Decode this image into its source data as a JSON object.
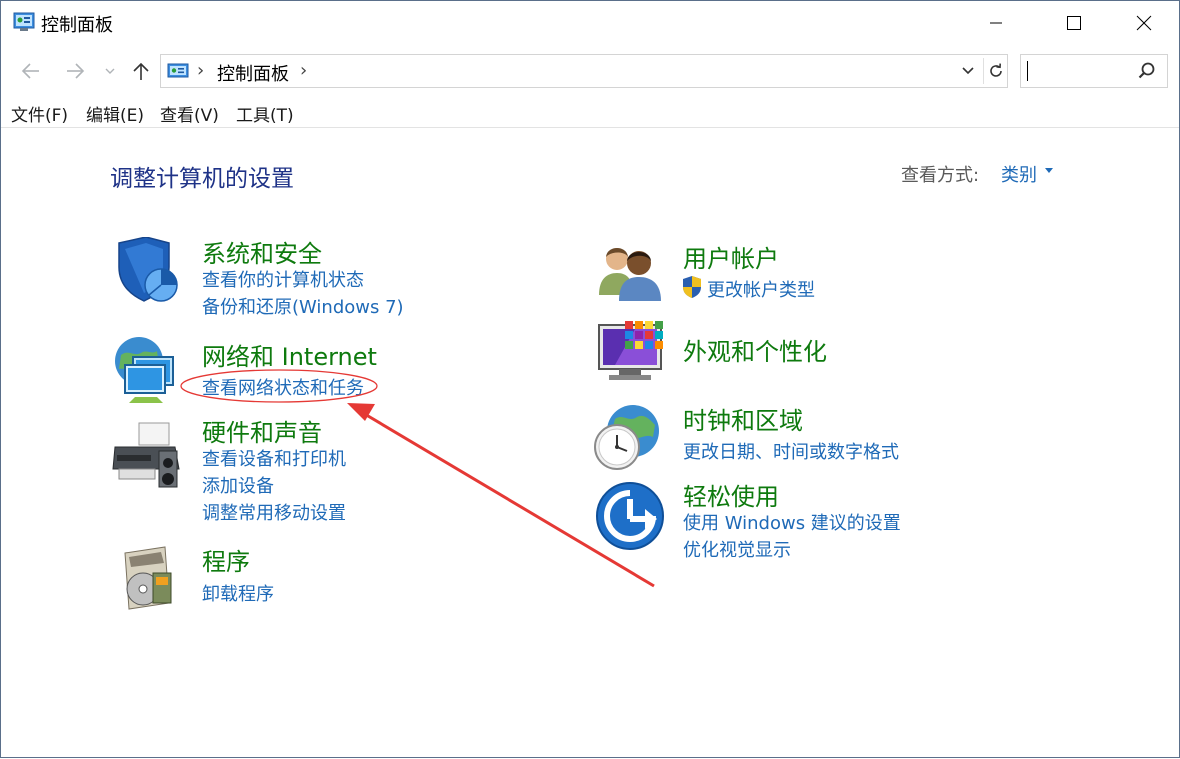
{
  "window": {
    "title": "控制面板",
    "minimize_icon": "minimize-icon",
    "maximize_icon": "maximize-icon",
    "close_icon": "close-icon"
  },
  "nav": {
    "back_icon": "arrow-left-icon",
    "forward_icon": "arrow-right-icon",
    "recent_icon": "chevron-down-icon",
    "up_icon": "arrow-up-icon",
    "address": {
      "breadcrumb": "控制面板",
      "separator": "›"
    },
    "search": {
      "placeholder": ""
    }
  },
  "menu": {
    "items": [
      "文件(F)",
      "编辑(E)",
      "查看(V)",
      "工具(T)"
    ]
  },
  "main": {
    "title": "调整计算机的设置",
    "view_by_label": "查看方式:",
    "view_by_value": "类别",
    "categories": [
      {
        "title": "系统和安全",
        "icon": "shield-icon",
        "links": [
          "查看你的计算机状态",
          "备份和还原(Windows 7)"
        ]
      },
      {
        "title": "网络和 Internet",
        "icon": "network-globe-icon",
        "links": [
          "查看网络状态和任务"
        ]
      },
      {
        "title": "硬件和声音",
        "icon": "printer-icon",
        "links": [
          "查看设备和打印机",
          "添加设备",
          "调整常用移动设置"
        ]
      },
      {
        "title": "程序",
        "icon": "programs-disc-icon",
        "links": [
          "卸载程序"
        ]
      },
      {
        "title": "用户帐户",
        "icon": "users-icon",
        "links": [
          "更改帐户类型"
        ]
      },
      {
        "title": "外观和个性化",
        "icon": "monitor-palette-icon",
        "links": []
      },
      {
        "title": "时钟和区域",
        "icon": "clock-globe-icon",
        "links": [
          "更改日期、时间或数字格式"
        ]
      },
      {
        "title": "轻松使用",
        "icon": "ease-of-access-icon",
        "links": [
          "使用 Windows 建议的设置",
          "优化视觉显示"
        ]
      }
    ]
  },
  "annotation": {
    "color": "#e53935"
  }
}
